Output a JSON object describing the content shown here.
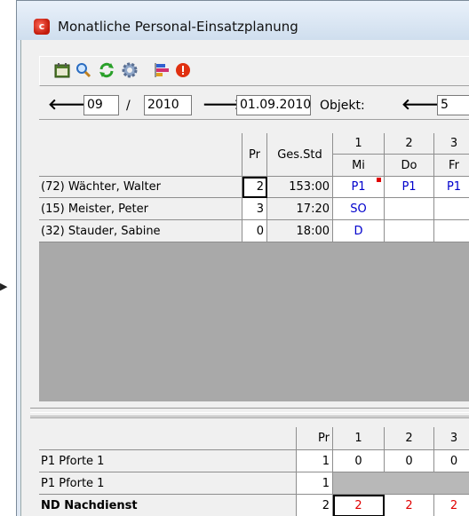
{
  "window": {
    "title": "Monatliche Personal-Einsatzplanung"
  },
  "edge_marker": "▶",
  "toolbar": {
    "icons": [
      "calendar-icon",
      "magnifier-icon",
      "refresh-arrows-icon",
      "gear-icon",
      "bar-chart-icon",
      "alert-icon"
    ]
  },
  "nav": {
    "month": "09",
    "sep": "/",
    "year": "2010",
    "date": "01.09.2010",
    "objekt_label": "Objekt:",
    "objekt_value": "5"
  },
  "plan_grid": {
    "headers": {
      "pr": "Pr",
      "ges_std": "Ges.Std"
    },
    "days": [
      {
        "num": "1",
        "dow": "Mi"
      },
      {
        "num": "2",
        "dow": "Do"
      },
      {
        "num": "3",
        "dow": "Fr"
      }
    ],
    "rows": [
      {
        "name": "(72) Wächter, Walter",
        "pr": "2",
        "hours": "153:00",
        "d1": "P1",
        "d2": "P1",
        "d3": "P1"
      },
      {
        "name": "(15) Meister, Peter",
        "pr": "3",
        "hours": "17:20",
        "d1": "SO",
        "d2": "",
        "d3": ""
      },
      {
        "name": "(32) Stauder, Sabine",
        "pr": "0",
        "hours": "18:00",
        "d1": "D",
        "d2": "",
        "d3": ""
      }
    ],
    "marker_color": "#e00000"
  },
  "summary_grid": {
    "headers": {
      "pr": "Pr",
      "d1": "1",
      "d2": "2",
      "d3": "3"
    },
    "rows": [
      {
        "name": "P1 Pforte 1",
        "pr": "1",
        "d1": "0",
        "d2": "0",
        "d3": "0"
      },
      {
        "name": "P1 Pforte 1",
        "pr": "1",
        "d1": "",
        "d2": "",
        "d3": ""
      },
      {
        "name": "ND Nachdienst",
        "pr": "2",
        "d1": "2",
        "d2": "2",
        "d3": "2"
      }
    ]
  },
  "colors": {
    "shift_code": "#0000cc",
    "count_warning": "#e00000",
    "grid_background": "#a9a9a9"
  }
}
